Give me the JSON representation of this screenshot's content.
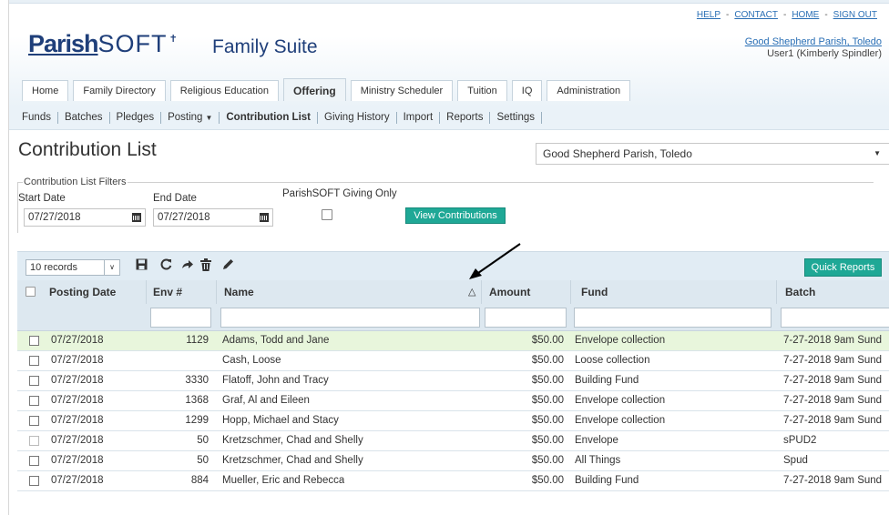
{
  "toplinks": {
    "help": "HELP",
    "contact": "CONTACT",
    "home": "HOME",
    "signout": "SIGN OUT",
    "sep": "-"
  },
  "user": {
    "parish_link": "Good Shepherd Parish, Toledo",
    "user_label": "User1 (Kimberly Spindler)"
  },
  "brand": {
    "logo_bold": "Parish",
    "logo_thin": "SOFT",
    "suite": "Family Suite"
  },
  "main_tabs": [
    {
      "label": "Home"
    },
    {
      "label": "Family Directory"
    },
    {
      "label": "Religious Education"
    },
    {
      "label": "Offering",
      "active": true
    },
    {
      "label": "Ministry Scheduler"
    },
    {
      "label": "Tuition"
    },
    {
      "label": "IQ"
    },
    {
      "label": "Administration"
    }
  ],
  "sub_nav": [
    {
      "label": "Funds"
    },
    {
      "label": "Batches"
    },
    {
      "label": "Pledges"
    },
    {
      "label": "Posting",
      "caret": "▼"
    },
    {
      "label": "Contribution List",
      "active": true
    },
    {
      "label": "Giving History"
    },
    {
      "label": "Import"
    },
    {
      "label": "Reports"
    },
    {
      "label": "Settings"
    }
  ],
  "page_title": "Contribution List",
  "parish_select": {
    "value": "Good Shepherd Parish, Toledo",
    "arrow": "▼"
  },
  "filters": {
    "legend": "Contribution List Filters",
    "start_label": "Start Date",
    "start_value": "07/27/2018",
    "end_label": "End Date",
    "end_value": "07/27/2018",
    "giving_only_label": "ParishSOFT Giving Only",
    "view_button": "View Contributions"
  },
  "toolbar": {
    "records": "10 records",
    "records_caret": "∨",
    "icons": [
      "save-icon",
      "refresh-icon",
      "export-icon",
      "delete-icon",
      "edit-icon"
    ],
    "quick_reports": "Quick Reports ▼"
  },
  "columns": {
    "posting_date": "Posting Date",
    "env": "Env #",
    "name": "Name",
    "name_sort": "△",
    "amount": "Amount",
    "fund": "Fund",
    "batch": "Batch"
  },
  "rows": [
    {
      "date": "07/27/2018",
      "env": "1129",
      "name": "Adams, Todd and Jane",
      "amount": "$50.00",
      "fund": "Envelope collection",
      "batch": "7-27-2018 9am Sund"
    },
    {
      "date": "07/27/2018",
      "env": "",
      "name": "Cash, Loose",
      "amount": "$50.00",
      "fund": "Loose collection",
      "batch": "7-27-2018 9am Sund"
    },
    {
      "date": "07/27/2018",
      "env": "3330",
      "name": "Flatoff, John and Tracy",
      "amount": "$50.00",
      "fund": "Building Fund",
      "batch": "7-27-2018 9am Sund"
    },
    {
      "date": "07/27/2018",
      "env": "1368",
      "name": "Graf, Al and Eileen",
      "amount": "$50.00",
      "fund": "Envelope collection",
      "batch": "7-27-2018 9am Sund"
    },
    {
      "date": "07/27/2018",
      "env": "1299",
      "name": "Hopp, Michael and Stacy",
      "amount": "$50.00",
      "fund": "Envelope collection",
      "batch": "7-27-2018 9am Sund"
    },
    {
      "date": "07/27/2018",
      "env": "50",
      "name": "Kretzschmer, Chad and Shelly",
      "amount": "$50.00",
      "fund": "Envelope",
      "batch": "sPUD2"
    },
    {
      "date": "07/27/2018",
      "env": "50",
      "name": "Kretzschmer, Chad and Shelly",
      "amount": "$50.00",
      "fund": "All Things",
      "batch": "Spud"
    },
    {
      "date": "07/27/2018",
      "env": "884",
      "name": "Mueller, Eric and Rebecca",
      "amount": "$50.00",
      "fund": "Building Fund",
      "batch": "7-27-2018 9am Sund"
    }
  ],
  "colors": {
    "accent": "#1fa896",
    "brand": "#1f3f7a",
    "link": "#2a6fb5",
    "highlight_row": "#e8f6dc"
  }
}
